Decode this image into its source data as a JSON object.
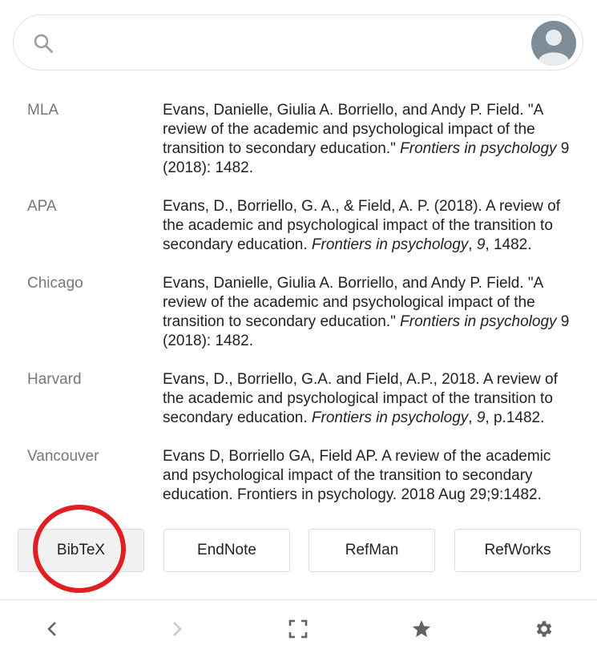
{
  "search": {
    "placeholder": ""
  },
  "citations": [
    {
      "style": "MLA",
      "parts": [
        {
          "t": "Evans, Danielle, Giulia A. Borriello, and Andy P. Field. \"A review of the academic and psychological impact of the transition to secondary education.\" "
        },
        {
          "t": "Frontiers in psychology",
          "i": true
        },
        {
          "t": " 9 (2018): 1482."
        }
      ]
    },
    {
      "style": "APA",
      "parts": [
        {
          "t": "Evans, D., Borriello, G. A., & Field, A. P. (2018). A review of the academic and psychological impact of the transition to secondary education. "
        },
        {
          "t": "Frontiers in psychology",
          "i": true
        },
        {
          "t": ", "
        },
        {
          "t": "9",
          "i": true
        },
        {
          "t": ", 1482."
        }
      ]
    },
    {
      "style": "Chicago",
      "parts": [
        {
          "t": "Evans, Danielle, Giulia A. Borriello, and Andy P. Field. \"A review of the academic and psychological impact of the transition to secondary education.\" "
        },
        {
          "t": "Frontiers in psychology",
          "i": true
        },
        {
          "t": " 9 (2018): 1482."
        }
      ]
    },
    {
      "style": "Harvard",
      "parts": [
        {
          "t": "Evans, D., Borriello, G.A. and Field, A.P., 2018. A review of the academic and psychological impact of the transition to secondary education. "
        },
        {
          "t": "Frontiers in psychology",
          "i": true
        },
        {
          "t": ", "
        },
        {
          "t": "9",
          "i": true
        },
        {
          "t": ", p.1482."
        }
      ]
    },
    {
      "style": "Vancouver",
      "parts": [
        {
          "t": "Evans D, Borriello GA, Field AP. A review of the academic and psychological impact of the transition to secondary education. Frontiers in psychology. 2018 Aug 29;9:1482."
        }
      ]
    }
  ],
  "export_buttons": {
    "bibtex": "BibTeX",
    "endnote": "EndNote",
    "refman": "RefMan",
    "refworks": "RefWorks"
  },
  "colors": {
    "annotation": "#e11e21",
    "avatar_bg": "#7d8c96",
    "icon": "#5f6368",
    "disabled_icon": "#c8c8c8"
  },
  "icons": {
    "search": "search-icon",
    "avatar": "avatar-icon",
    "back": "chevron-left-icon",
    "forward": "chevron-right-icon",
    "fullscreen": "fullscreen-icon",
    "star": "star-icon",
    "settings": "gear-icon"
  }
}
